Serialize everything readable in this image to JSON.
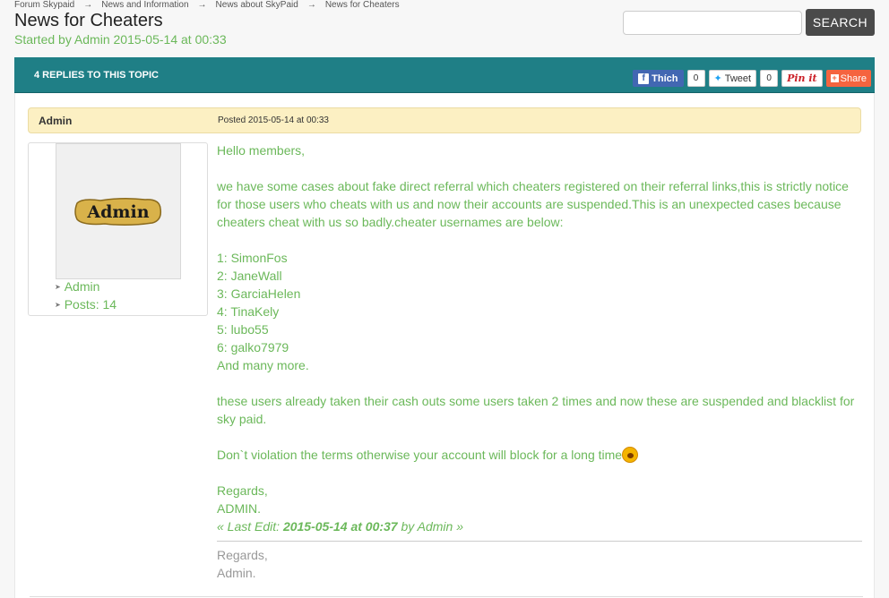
{
  "breadcrumb": {
    "items": [
      "Forum Skypaid",
      "News and Information",
      "News about SkyPaid",
      "News for Cheaters"
    ],
    "separator": "→"
  },
  "topic": {
    "title": "News for Cheaters",
    "started_prefix": "Started by Admin 2015-05-14 at 00:33"
  },
  "search": {
    "placeholder": "",
    "button_label": "SEARCH"
  },
  "topic_bar": {
    "replies_label": "4 REPLIES TO THIS TOPIC",
    "facebook_label": "Thích",
    "facebook_count": "0",
    "tweet_label": "Tweet",
    "tweet_count": "0",
    "pinterest_label": "Pin it",
    "share_label": "Share"
  },
  "post": {
    "author": "Admin",
    "posted": "Posted 2015-05-14 at 00:33",
    "avatar_text": "Admin",
    "profile_group": "Admin",
    "profile_posts": "Posts: 14",
    "greeting": "Hello members,",
    "para1": "we have some cases about fake direct referral which cheaters registered on their referral links,this is strictly notice for those users who cheats with us and now their accounts are suspended.This is an unexpected cases because cheaters cheat with us so badly.cheater usernames are below:",
    "cheaters": [
      "1: SimonFos",
      "2: JaneWall",
      "3: GarciaHelen",
      "4: TinaKely",
      "5: lubo55",
      "6: galko7979"
    ],
    "and_more": "And many more.",
    "para2": "these users already taken their cash outs some users taken 2 times and now these are suspended and blacklist for sky paid.",
    "para3": "Don`t violation the terms otherwise your account will block for a long time",
    "regards": "Regards,",
    "signoff": "ADMIN.",
    "last_edit_prefix": "« Last Edit: ",
    "last_edit_date": "2015-05-14 at 00:37",
    "last_edit_by": " by Admin »",
    "sig_regards": "Regards,",
    "sig_name": "Admin."
  },
  "colors": {
    "accent_teal": "#1f7f86",
    "post_text_green": "#6bb85a",
    "header_yellow": "#fcf0c3"
  }
}
